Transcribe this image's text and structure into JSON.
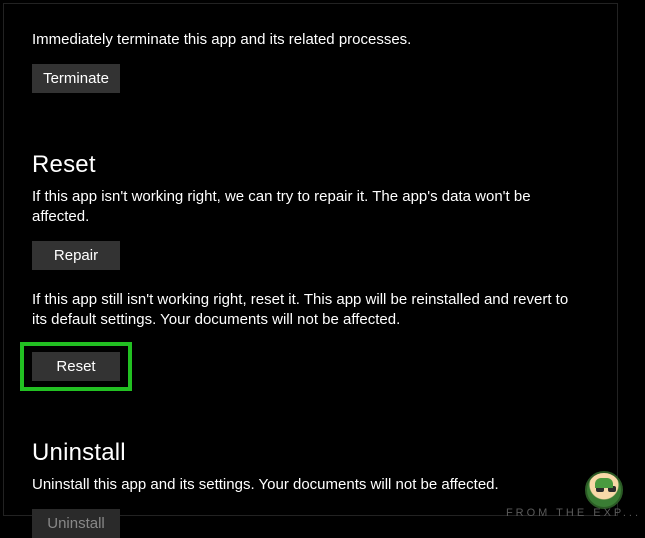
{
  "terminate": {
    "description": "Immediately terminate this app and its related processes.",
    "button_label": "Terminate"
  },
  "reset": {
    "heading": "Reset",
    "repair_description": "If this app isn't working right, we can try to repair it. The app's data won't be affected.",
    "repair_button_label": "Repair",
    "reset_description": "If this app still isn't working right, reset it. This app will be reinstalled and revert to its default settings. Your documents will not be affected.",
    "reset_button_label": "Reset"
  },
  "uninstall": {
    "heading": "Uninstall",
    "description": "Uninstall this app and its settings. Your documents will not be affected.",
    "button_label": "Uninstall"
  },
  "watermark": "FROM THE EXP..."
}
